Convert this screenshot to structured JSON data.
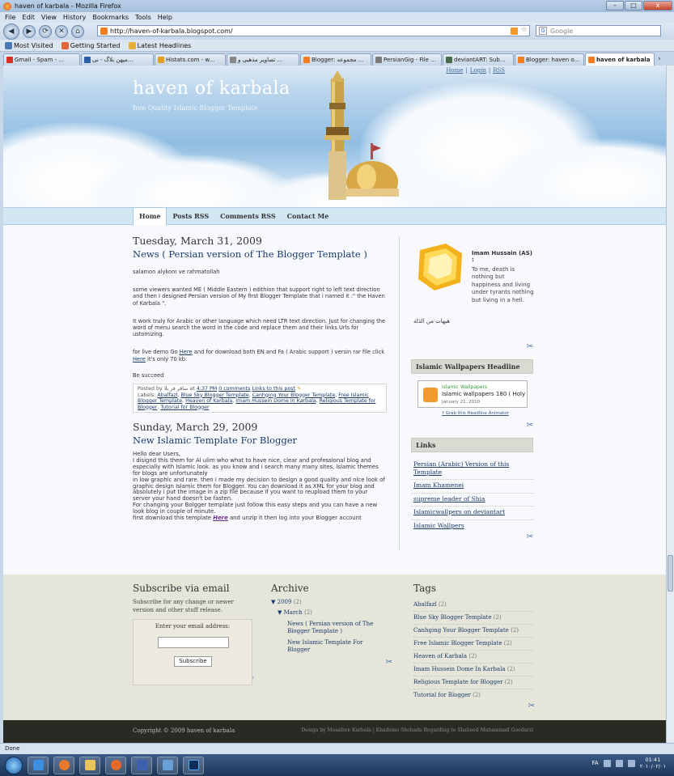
{
  "window": {
    "title": "haven of karbala - Mozilla Firefox",
    "min": "–",
    "max": "□",
    "close": "x"
  },
  "menu": [
    "File",
    "Edit",
    "View",
    "History",
    "Bookmarks",
    "Tools",
    "Help"
  ],
  "nav": {
    "back": "◀",
    "forward": "▶",
    "reload": "⟳",
    "stop": "✕",
    "home": "⌂",
    "url": "http://haven-of-karbala.blogspot.com/",
    "search_placeholder": "Google"
  },
  "bookmarks": [
    "Most Visited",
    "Getting Started",
    "Latest Headlines"
  ],
  "tabs": [
    {
      "label": "Gmail - Spam - ...",
      "color": "#d93025"
    },
    {
      "label": "میهن بلاگ - نی...",
      "color": "#2b5fa8"
    },
    {
      "label": "Histats.com - w...",
      "color": "#e0a21a"
    },
    {
      "label": "تصاویر مذهبی و ...",
      "color": "#888888"
    },
    {
      "label": "Blogger: مجموعه ...",
      "color": "#f47b20"
    },
    {
      "label": "PersianGig - File ...",
      "color": "#7a7a7a"
    },
    {
      "label": "deviantART: Sub...",
      "color": "#4a6b4a"
    },
    {
      "label": "Blogger: haven o...",
      "color": "#f47b20"
    },
    {
      "label": "haven of karbala",
      "color": "#f47b20",
      "active": true
    }
  ],
  "blog": {
    "toplinks": [
      "Home",
      "|",
      "Login",
      "|",
      "RSS"
    ],
    "title": "haven of karbala",
    "description": "free Quality Islamic Blogger Template",
    "navitems": [
      "Home",
      "Posts RSS",
      "Comments RSS",
      "Contact Me"
    ]
  },
  "post1": {
    "date": "Tuesday, March 31, 2009",
    "title": "News ( Persian version of The Blogger Template )",
    "p1": "salamon alykom ve rahmatollah",
    "p2": "some viewers wanted ME ( Middle Eastern ) edithion that support right to left text direction and then I designed Persian version of My first Blogger Template that i named it :\" the Haven of Karbala \".",
    "p3": "It work truly for Arabic or other language which need LTR text direction. Just for changing the word of menu search the word in the code and replace them and their links Urls for ustomizing.",
    "p4a": "for live demo Go ",
    "p4link1": "Here",
    "p4b": " and for download both EN and Fa ( Arabic support ) versin rar file click ",
    "p4link2": "Here",
    "p4c": " it's only 70 kb.",
    "p5": "Be succeed",
    "postedby": "Posted by ساقر فر بلا at ",
    "time": "4:37 PM",
    "comments": "0 comments",
    "linkto": "Links to this post",
    "labels_prefix": "Labels: ",
    "labels": [
      "Abalfazl",
      "Blue Sky Blogger Template",
      "Canhging Your Blogger Template",
      "Free Islamic Blogger Template",
      "Heaven of Karbala",
      "Imam Hussein Dome In Karbala",
      "Religious Template for Blogger",
      "Tutorial for Blogger"
    ]
  },
  "post2": {
    "date": "Sunday, March 29, 2009",
    "title": "New Islamic Template For Blogger",
    "l1": "Hello dear Users,",
    "l2": "I disignd this them for Al ulim who what to have nice, clear and professional blog and especially with Islamic look. as you know and i search many many sites, Islamic themes for blogs are unfortunately",
    "l3": "in low graphic and rare. then i made my decision to design a good quality and nice look of graphic design Islamic them for Blogger. You can download it as XML for your blog and absolutely i put the image in a zip file because if you want to reupload them to your server your hand doesn't be fasten.",
    "l4": "For changing your Bolgger template just follow this easy steps and you can have a new look blog in couple of minute.",
    "l5a": "first download this template ",
    "l5link": "Here",
    "l5b": " and unzip it then log into your Blogger account"
  },
  "sidebar": {
    "profile_name": "Imam Hussain (AS) :",
    "quote": "To me, death is nothing but happiness and living under tyrants nothing but living in a hell.",
    "arabic": "هیهات من الذلة",
    "wallpapers_head": "Islamic Wallpapers Headline",
    "feed_source": "Islamic Wallpapers",
    "feed_headline": "Islamic wallpapers 180 ( Holy",
    "feed_date": "January 21, 2010",
    "grab": "† Grab this Headline Animator",
    "links_head": "Links",
    "links": [
      "Persian (Arabic) Version of this Template",
      "Imam Khamenei",
      "supreme leader of Shia",
      "Islamicwallpers on deviantart",
      "Islamic Wallpers"
    ],
    "tool_icon": "✂"
  },
  "subscribe": {
    "head": "Subscribe via email",
    "desc": "Subscribe for any change or newer version and other stuff release.",
    "label": "Enter your email address:",
    "button": "Subscribe"
  },
  "archive": {
    "head": "Archive",
    "year": "2009",
    "year_count": "(2)",
    "month": "March",
    "month_count": "(2)",
    "posts": [
      "News ( Persian version of The Blogger Template )",
      "New Islamic Template For Blogger"
    ]
  },
  "tags": {
    "head": "Tags",
    "items": [
      {
        "name": "Abalfazl",
        "count": "(2)"
      },
      {
        "name": "Blue Sky Blogger Template",
        "count": "(2)"
      },
      {
        "name": "Canhging Your Blogger Template",
        "count": "(2)"
      },
      {
        "name": "Free Islamic Blogger Template",
        "count": "(2)"
      },
      {
        "name": "Heaven of Karbala",
        "count": "(2)"
      },
      {
        "name": "Imam Hussein Dome In Karbala",
        "count": "(2)"
      },
      {
        "name": "Religious Template for Blogger",
        "count": "(2)"
      },
      {
        "name": "Tutorial for Blogger",
        "count": "(2)"
      }
    ]
  },
  "footer": {
    "copyright": "Copyright © 2009 haven of karbala",
    "design": "Design by Mosafere Karbala | Khademo Shohada Regarding to Shaheed Muhammad Goodarzi"
  },
  "status": "Done",
  "taskbar": {
    "lang": "FA",
    "time": "01:41",
    "date": "٢٠١٠/٠٢/٠١"
  }
}
